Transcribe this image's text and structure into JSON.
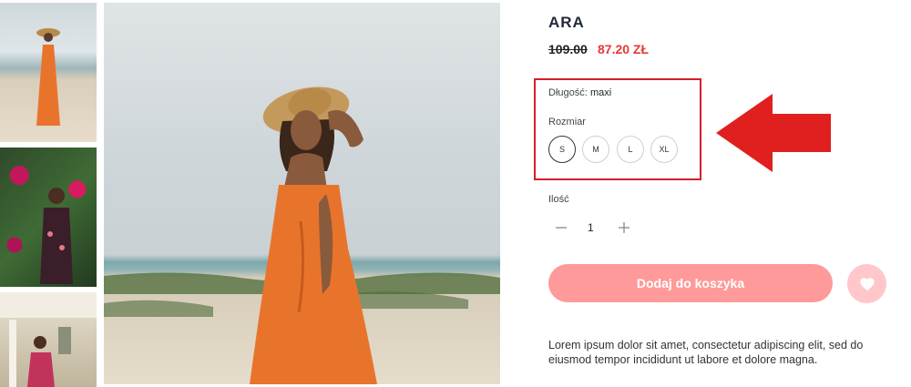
{
  "product": {
    "title": "ARA",
    "old_price": "109.00",
    "new_price": "87.20 ZŁ"
  },
  "options": {
    "length_label": "Długość:",
    "length_value": "maxi",
    "size_label": "Rozmiar",
    "sizes": [
      "S",
      "M",
      "L",
      "XL"
    ],
    "selected_size": "S"
  },
  "quantity": {
    "label": "Ilość",
    "value": "1",
    "minus_icon": "minus-icon",
    "plus_icon": "plus-icon"
  },
  "actions": {
    "add_to_cart": "Dodaj do koszyka",
    "wishlist_icon": "heart-icon"
  },
  "description": "Lorem ipsum dolor sit amet, consectetur adipiscing elit, sed do eiusmod tempor incididunt ut labore et dolore magna.",
  "colors": {
    "price_sale": "#e53935",
    "button": "#fe9a9a",
    "wishlist": "#ffc7c9",
    "highlight": "#d51f26"
  }
}
